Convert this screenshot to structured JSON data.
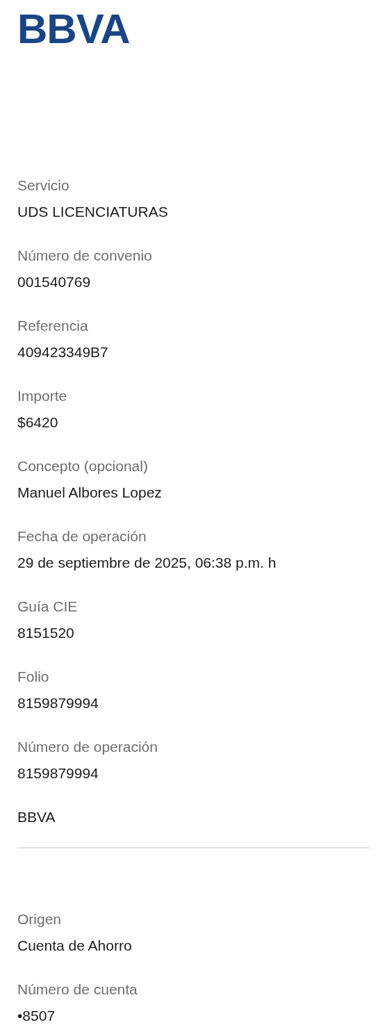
{
  "logo": {
    "text": "BBVA"
  },
  "sections": [
    {
      "fields": [
        {
          "label": "Servicio",
          "value": "UDS LICENCIATURAS"
        },
        {
          "label": "Número de convenio",
          "value": "001540769"
        },
        {
          "label": "Referencia",
          "value": "409423349B7"
        },
        {
          "label": "Importe",
          "value": "$6420"
        },
        {
          "label": "Concepto (opcional)",
          "value": "Manuel Albores Lopez"
        },
        {
          "label": "Fecha de operación",
          "value": "29 de septiembre de 2025, 06:38 p.m. h"
        },
        {
          "label": "Guía CIE",
          "value": "8151520"
        },
        {
          "label": "Folio",
          "value": "8159879994"
        },
        {
          "label": "Número de operación",
          "value": "8159879994"
        },
        {
          "value": "BBVA"
        }
      ]
    },
    {
      "fields": [
        {
          "label": "Origen",
          "value": "Cuenta de Ahorro"
        },
        {
          "label": "Número de cuenta",
          "value": "•8507"
        }
      ]
    }
  ]
}
